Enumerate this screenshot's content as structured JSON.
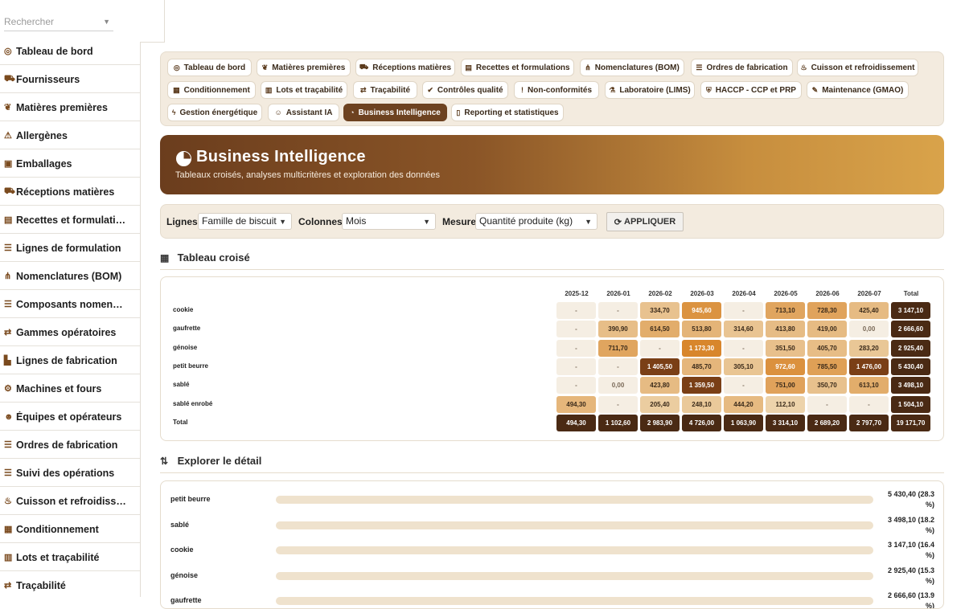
{
  "sidebar": {
    "search_placeholder": "Rechercher",
    "items": [
      {
        "icon": "gauge-icon",
        "glyph": "◎",
        "label": "Tableau de bord"
      },
      {
        "icon": "truck-icon",
        "glyph": "⛟",
        "label": "Fournisseurs"
      },
      {
        "icon": "seedling-icon",
        "glyph": "❦",
        "label": "Matières premières"
      },
      {
        "icon": "warning-icon",
        "glyph": "⚠",
        "label": "Allergènes"
      },
      {
        "icon": "box-icon",
        "glyph": "▣",
        "label": "Emballages"
      },
      {
        "icon": "truck-loading-icon",
        "glyph": "⛟",
        "label": "Réceptions matières"
      },
      {
        "icon": "book-icon",
        "glyph": "▤",
        "label": "Recettes et formulati…"
      },
      {
        "icon": "list-icon",
        "glyph": "☰",
        "label": "Lignes de formulation"
      },
      {
        "icon": "sitemap-icon",
        "glyph": "⋔",
        "label": "Nomenclatures (BOM)"
      },
      {
        "icon": "list-icon",
        "glyph": "☰",
        "label": "Composants nomen…"
      },
      {
        "icon": "route-icon",
        "glyph": "⇄",
        "label": "Gammes opératoires"
      },
      {
        "icon": "industry-icon",
        "glyph": "▙",
        "label": "Lignes de fabrication"
      },
      {
        "icon": "cogs-icon",
        "glyph": "⚙",
        "label": "Machines et fours"
      },
      {
        "icon": "users-icon",
        "glyph": "☻",
        "label": "Équipes et opérateurs"
      },
      {
        "icon": "list-icon",
        "glyph": "☰",
        "label": "Ordres de fabrication"
      },
      {
        "icon": "list-icon",
        "glyph": "☰",
        "label": "Suivi des opérations"
      },
      {
        "icon": "fire-icon",
        "glyph": "♨",
        "label": "Cuisson et refroidiss…"
      },
      {
        "icon": "boxes-icon",
        "glyph": "▦",
        "label": "Conditionnement"
      },
      {
        "icon": "barcode-icon",
        "glyph": "▥",
        "label": "Lots et traçabilité"
      },
      {
        "icon": "route-icon",
        "glyph": "⇄",
        "label": "Traçabilité"
      }
    ]
  },
  "tabs": [
    {
      "icon": "gauge-icon",
      "glyph": "◎",
      "label": "Tableau de bord",
      "active": false
    },
    {
      "icon": "seedling-icon",
      "glyph": "❦",
      "label": "Matières premières",
      "active": false
    },
    {
      "icon": "truck-loading-icon",
      "glyph": "⛟",
      "label": "Réceptions matières",
      "active": false
    },
    {
      "icon": "book-icon",
      "glyph": "▤",
      "label": "Recettes et formulations",
      "active": false
    },
    {
      "icon": "sitemap-icon",
      "glyph": "⋔",
      "label": "Nomenclatures (BOM)",
      "active": false
    },
    {
      "icon": "list-icon",
      "glyph": "☰",
      "label": "Ordres de fabrication",
      "active": false
    },
    {
      "icon": "fire-icon",
      "glyph": "♨",
      "label": "Cuisson et refroidissement",
      "active": false
    },
    {
      "icon": "boxes-icon",
      "glyph": "▦",
      "label": "Conditionnement",
      "active": false
    },
    {
      "icon": "barcode-icon",
      "glyph": "▥",
      "label": "Lots et traçabilité",
      "active": false
    },
    {
      "icon": "route-icon",
      "glyph": "⇄",
      "label": "Traçabilité",
      "active": false
    },
    {
      "icon": "check-circle-icon",
      "glyph": "✔",
      "label": "Contrôles qualité",
      "active": false
    },
    {
      "icon": "exclamation-circle-icon",
      "glyph": "!",
      "label": "Non-conformités",
      "active": false
    },
    {
      "icon": "flask-icon",
      "glyph": "⚗",
      "label": "Laboratoire (LIMS)",
      "active": false
    },
    {
      "icon": "shield-icon",
      "glyph": "⛨",
      "label": "HACCP - CCP et PRP",
      "active": false
    },
    {
      "icon": "wrench-icon",
      "glyph": "✎",
      "label": "Maintenance (GMAO)",
      "active": false
    },
    {
      "icon": "bolt-icon",
      "glyph": "ϟ",
      "label": "Gestion énergétique",
      "active": false
    },
    {
      "icon": "robot-icon",
      "glyph": "☺",
      "label": "Assistant IA",
      "active": false
    },
    {
      "icon": "chart-pie-icon",
      "glyph": "◔",
      "label": "Business Intelligence",
      "active": true
    },
    {
      "icon": "file-icon",
      "glyph": "▯",
      "label": "Reporting et statistiques",
      "active": false
    }
  ],
  "hero": {
    "title": "Business Intelligence",
    "subtitle": "Tableaux croisés, analyses multicritères et exploration des données"
  },
  "filters": {
    "rows_label": "Lignes",
    "rows_value": "Famille de biscuit",
    "cols_label": "Colonnes",
    "cols_value": "Mois",
    "measure_label": "Mesure",
    "measure_value": "Quantité produite (kg)",
    "apply_label": "APPLIQUER"
  },
  "pivot": {
    "title": "Tableau croisé",
    "columns": [
      "2025-12",
      "2026-01",
      "2026-02",
      "2026-03",
      "2026-04",
      "2026-05",
      "2026-06",
      "2026-07",
      "Total"
    ],
    "rows": [
      {
        "label": "cookie",
        "cells": [
          "-",
          "-",
          "334,70",
          "945,60",
          "-",
          "713,10",
          "728,30",
          "425,40",
          "3 147,10"
        ],
        "levels": [
          0,
          0,
          0.3,
          0.85,
          0,
          0.64,
          0.66,
          0.38,
          null
        ]
      },
      {
        "label": "gaufrette",
        "cells": [
          "-",
          "390,90",
          "614,50",
          "513,80",
          "314,60",
          "413,80",
          "419,00",
          "0,00",
          "2 666,60"
        ],
        "levels": [
          0,
          0.35,
          0.55,
          0.46,
          0.28,
          0.37,
          0.38,
          0,
          null
        ]
      },
      {
        "label": "génoise",
        "cells": [
          "-",
          "711,70",
          "-",
          "1 173,30",
          "-",
          "351,50",
          "405,70",
          "283,20",
          "2 925,40"
        ],
        "levels": [
          0,
          0.64,
          0,
          1.0,
          0,
          0.32,
          0.36,
          0.25,
          null
        ]
      },
      {
        "label": "petit beurre",
        "cells": [
          "-",
          "-",
          "1 405,50",
          "485,70",
          "305,10",
          "972,60",
          "785,50",
          "1 476,00",
          "5 430,40"
        ],
        "levels": [
          0,
          0,
          1.2,
          0.44,
          0.27,
          0.87,
          0.7,
          1.2,
          null
        ]
      },
      {
        "label": "sablé",
        "cells": [
          "-",
          "0,00",
          "423,80",
          "1 359,50",
          "-",
          "751,00",
          "350,70",
          "613,10",
          "3 498,10"
        ],
        "levels": [
          0,
          0,
          0.38,
          1.2,
          0,
          0.67,
          0.31,
          0.55,
          null
        ]
      },
      {
        "label": "sablé enrobé",
        "cells": [
          "494,30",
          "-",
          "205,40",
          "248,10",
          "444,20",
          "112,10",
          "-",
          "-",
          "1 504,10"
        ],
        "levels": [
          0.44,
          0,
          0.18,
          0.22,
          0.4,
          0.1,
          0,
          0,
          null
        ]
      },
      {
        "label": "Total",
        "cells": [
          "494,30",
          "1 102,60",
          "2 983,90",
          "4 726,00",
          "1 063,90",
          "3 314,10",
          "2 689,20",
          "2 797,70",
          "19 171,70"
        ],
        "levels": [
          null,
          null,
          null,
          null,
          null,
          null,
          null,
          null,
          null
        ]
      }
    ]
  },
  "detail": {
    "title": "Explorer le détail",
    "items": [
      {
        "label": "petit beurre",
        "value": "5 430,40 (28.3 %)",
        "share": 0.283
      },
      {
        "label": "sablé",
        "value": "3 498,10 (18.2 %)",
        "share": 0.182
      },
      {
        "label": "cookie",
        "value": "3 147,10 (16.4 %)",
        "share": 0.164
      },
      {
        "label": "génoise",
        "value": "2 925,40 (15.3 %)",
        "share": 0.153
      },
      {
        "label": "gaufrette",
        "value": "2 666,60 (13.9 %)",
        "share": 0.139
      }
    ]
  },
  "colors": {
    "accent_dark": "#6d4220",
    "total_cell": "#4a2a14",
    "cell_empty": "#f5eee3",
    "heat_low": "#efdcb9",
    "heat_high": "#c9761f",
    "heat_max": "#7a3f16"
  }
}
